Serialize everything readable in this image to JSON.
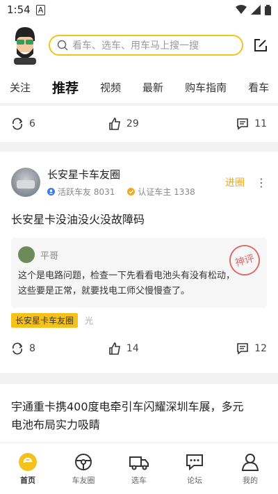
{
  "status": {
    "time": "1:54",
    "notif": "A"
  },
  "search": {
    "placeholder": "看车、选车、用车马上搜一搜"
  },
  "tabs": [
    "关注",
    "推荐",
    "视频",
    "最新",
    "购车指南",
    "看车"
  ],
  "card1": {
    "shares": "6",
    "likes": "29",
    "comments": "11"
  },
  "card2": {
    "group_name": "长安星卡车友圈",
    "active_members": "活跃车友 8031",
    "certified_owners": "认证车主 1338",
    "join_label": "进圈",
    "post_title": "长安星卡没油没火没故障码",
    "comment": {
      "author": "平哥",
      "stamp": "神评",
      "text_line1": "这个是电路问题，检查一下先看看电池头有没有松动，",
      "text_line2": "这些要是正常，就要找电工师父慢慢查了。"
    },
    "tag": "长安星卡车友圈",
    "tag_extra": "光",
    "shares": "8",
    "likes": "14",
    "comments": "12"
  },
  "card3": {
    "title_line1": "宇通重卡携400度电牵引车闪耀深圳车展，多元",
    "title_line2": "电池布局实力吸睛"
  },
  "nav": [
    "首页",
    "车友圈",
    "选车",
    "论坛",
    "我的"
  ],
  "colors": {
    "accent": "#f4c21b",
    "join": "#f0a81e",
    "stamp": "#d9534f"
  }
}
